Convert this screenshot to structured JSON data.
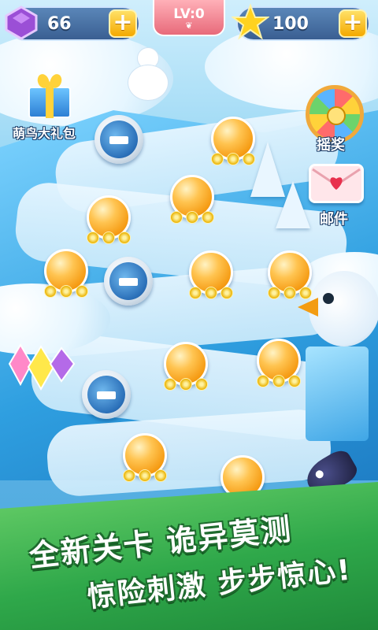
{
  "hud": {
    "gems": "66",
    "level_tab": "LV:0",
    "stars": "100",
    "plus_label": "+"
  },
  "side": {
    "gift_label": "萌鸟大礼包",
    "wheel_label": "摇奖",
    "mail_label": "邮件"
  },
  "map": {
    "level_nodes": [
      "node",
      "node",
      "node",
      "node",
      "node",
      "node",
      "node",
      "node",
      "node",
      "node"
    ],
    "locked_nodes": [
      "locked",
      "locked",
      "locked"
    ]
  },
  "banner": {
    "line1": "全新关卡 诡异莫测",
    "line2": "惊险刺激 步步惊心!"
  },
  "colors": {
    "hud_pill": "#3a5f92",
    "level_tab": "#e86a7a",
    "node_orange": "#f59a12",
    "banner_green": "#2fa84a"
  }
}
